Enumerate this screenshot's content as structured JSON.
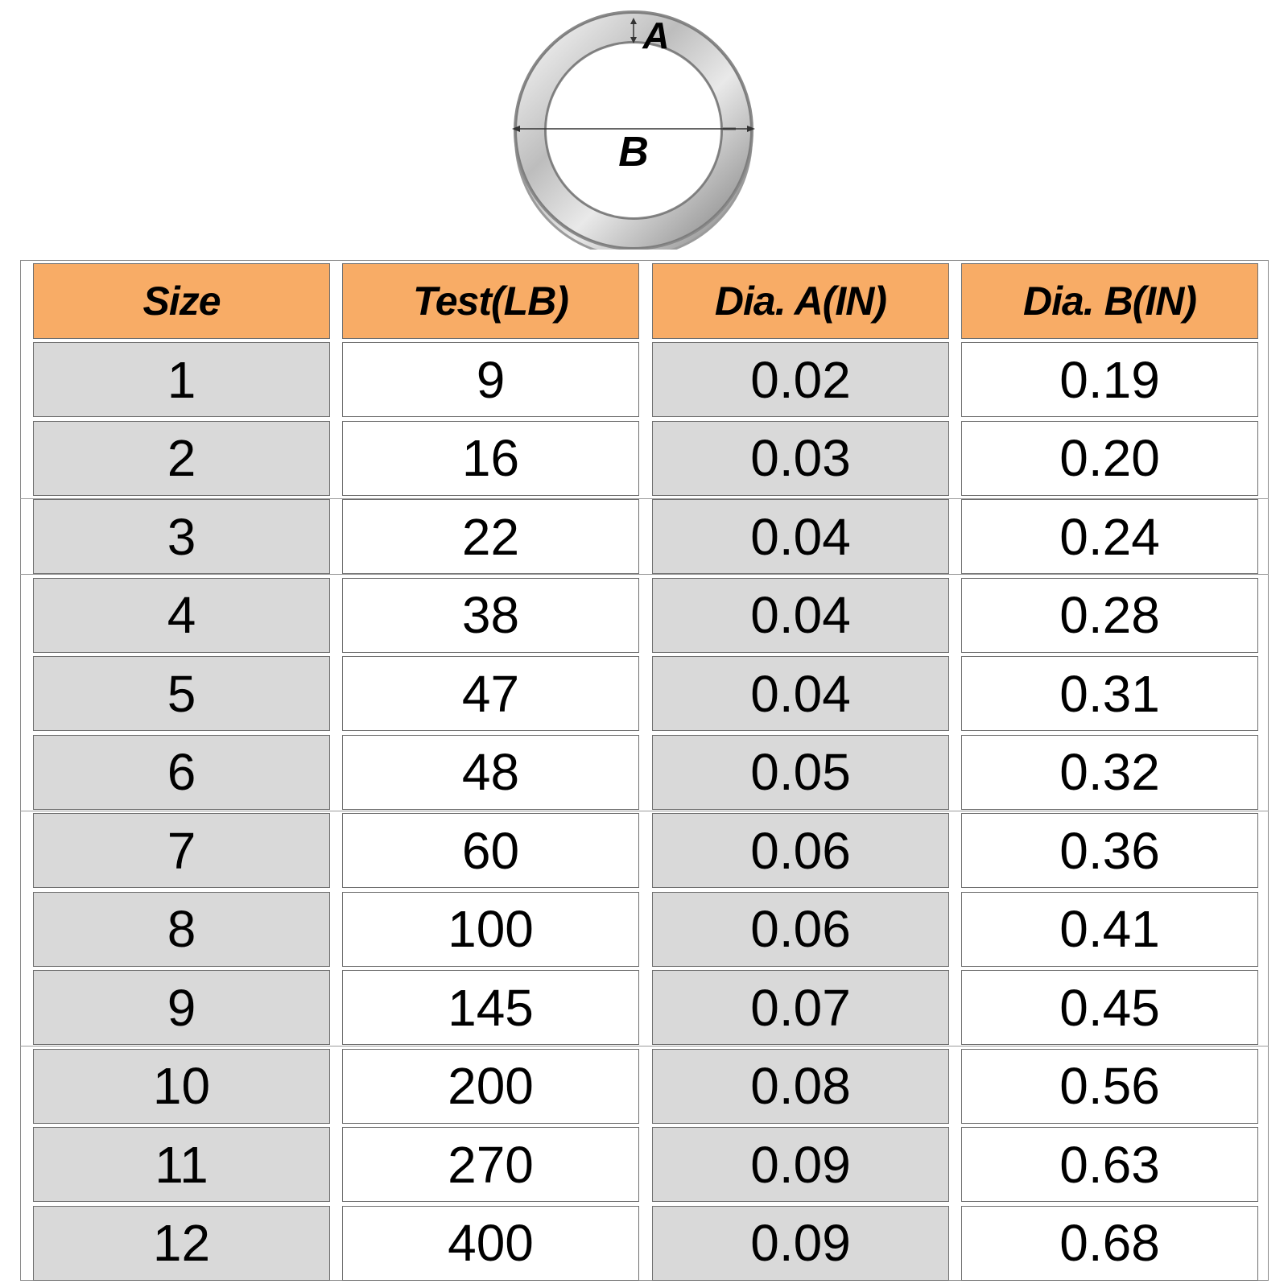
{
  "figure": {
    "label_a": "A",
    "label_b": "B"
  },
  "table": {
    "headers": [
      "Size",
      "Test(LB)",
      "Dia. A(IN)",
      "Dia. B(IN)"
    ],
    "rows": [
      [
        "1",
        "9",
        "0.02",
        "0.19"
      ],
      [
        "2",
        "16",
        "0.03",
        "0.20"
      ],
      [
        "3",
        "22",
        "0.04",
        "0.24"
      ],
      [
        "4",
        "38",
        "0.04",
        "0.28"
      ],
      [
        "5",
        "47",
        "0.04",
        "0.31"
      ],
      [
        "6",
        "48",
        "0.05",
        "0.32"
      ],
      [
        "7",
        "60",
        "0.06",
        "0.36"
      ],
      [
        "8",
        "100",
        "0.06",
        "0.41"
      ],
      [
        "9",
        "145",
        "0.07",
        "0.45"
      ],
      [
        "10",
        "200",
        "0.08",
        "0.56"
      ],
      [
        "11",
        "270",
        "0.09",
        "0.63"
      ],
      [
        "12",
        "400",
        "0.09",
        "0.68"
      ]
    ]
  },
  "colors": {
    "header_fill": "#f8ac66",
    "grey_fill": "#d9d9d9",
    "white_fill": "#ffffff"
  }
}
